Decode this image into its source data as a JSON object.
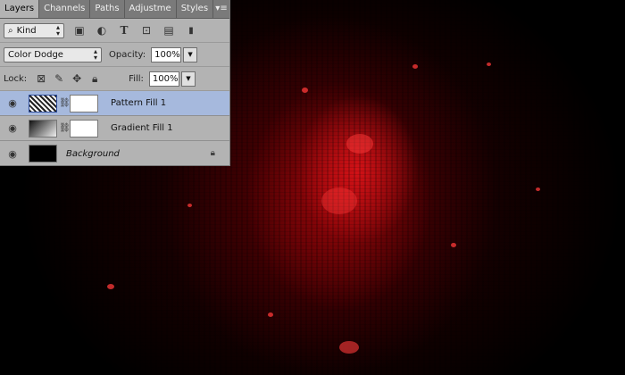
{
  "tabs": [
    "Layers",
    "Channels",
    "Paths",
    "Adjustme",
    "Styles"
  ],
  "filter": {
    "icon": "search-icon",
    "kind_label": "Kind"
  },
  "blend_mode": "Color Dodge",
  "opacity": {
    "label": "Opacity:",
    "value": "100%"
  },
  "lock": {
    "label": "Lock:"
  },
  "fill": {
    "label": "Fill:",
    "value": "100%"
  },
  "layers": [
    {
      "name": "Pattern Fill 1",
      "selected": true
    },
    {
      "name": "Gradient Fill 1",
      "selected": false
    },
    {
      "name": "Background",
      "selected": false
    }
  ],
  "colors": {
    "selected_row": "#a6b9dd",
    "panel_bg": "#b3b3b3"
  }
}
